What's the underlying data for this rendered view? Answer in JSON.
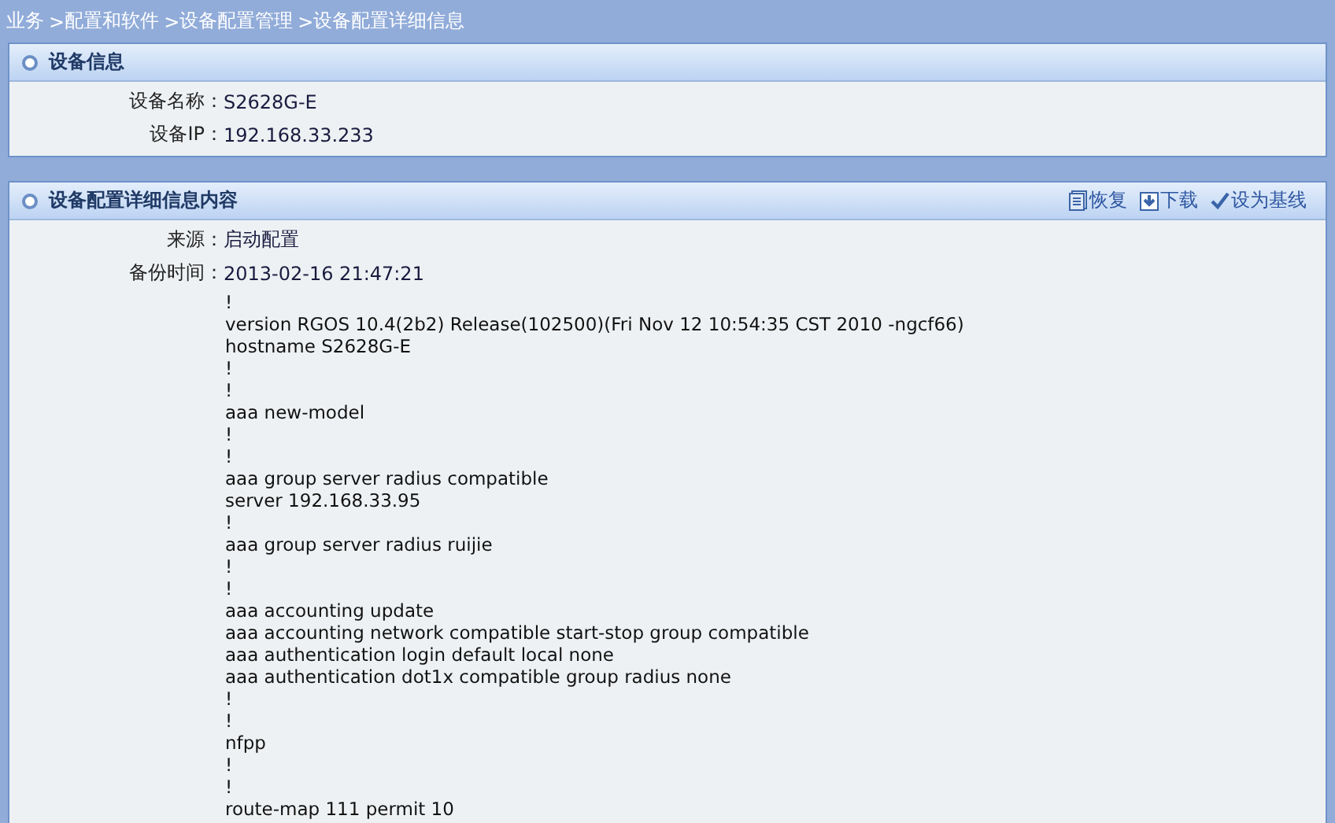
{
  "breadcrumb": [
    {
      "label": "业务"
    },
    {
      "sep": ">",
      "label": "配置和软件"
    },
    {
      "sep": ">",
      "label": "设备配置管理"
    },
    {
      "sep": ">",
      "label": "设备配置详细信息"
    }
  ],
  "device_info": {
    "title": "设备信息",
    "fields": [
      {
        "label": "设备名称：",
        "value": "S2628G-E"
      },
      {
        "label": "设备IP：",
        "value": "192.168.33.233"
      }
    ]
  },
  "config_detail": {
    "title": "设备配置详细信息内容",
    "actions": [
      {
        "kind": "restore",
        "label": "恢复"
      },
      {
        "kind": "download",
        "label": "下载"
      },
      {
        "kind": "baseline",
        "label": "设为基线"
      }
    ],
    "fields": [
      {
        "label": "来源：",
        "value": "启动配置"
      },
      {
        "label": "备份时间：",
        "value": "2013-02-16 21:47:21"
      }
    ],
    "config_lines": [
      "!",
      "version RGOS 10.4(2b2) Release(102500)(Fri Nov 12 10:54:35 CST 2010 -ngcf66)",
      "hostname S2628G-E",
      "!",
      "!",
      "aaa new-model",
      "!",
      "!",
      "aaa group server radius compatible",
      "server 192.168.33.95",
      "!",
      "aaa group server radius ruijie",
      "!",
      "!",
      "aaa accounting update",
      "aaa accounting network compatible start-stop group compatible",
      "aaa authentication login default local none",
      "aaa authentication dot1x compatible group radius none",
      "!",
      "!",
      "nfpp",
      "!",
      "!",
      "route-map 111 permit 10"
    ]
  }
}
